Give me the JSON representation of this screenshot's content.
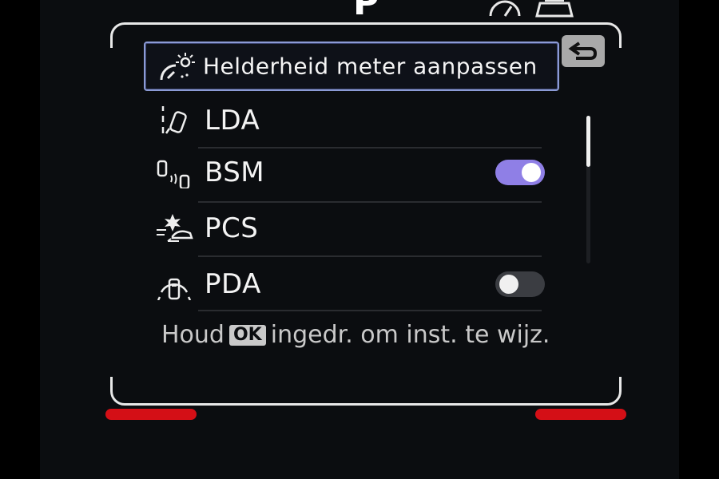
{
  "header": {
    "gear": "P",
    "icons": [
      "speedometer-icon",
      "car-front-icon"
    ]
  },
  "back_icon": "back-arrow-icon",
  "menu": {
    "items": [
      {
        "label": "Helderheid meter aanpassen",
        "icon": "meter-brightness-icon",
        "selected": true
      },
      {
        "label": "LDA",
        "icon": "lane-departure-icon"
      },
      {
        "label": "BSM",
        "icon": "blind-spot-icon",
        "toggle": "on"
      },
      {
        "label": "PCS",
        "icon": "pre-collision-icon"
      },
      {
        "label": "PDA",
        "icon": "proactive-driving-icon",
        "toggle": "off"
      }
    ]
  },
  "hint": {
    "prefix": "Houd",
    "key": "OK",
    "suffix": "ingedr. om inst. te wijz."
  },
  "colors": {
    "toggle_on": "#8f7fe6",
    "selection_border": "#8c9bd6",
    "red_indicator": "#d40f16"
  }
}
